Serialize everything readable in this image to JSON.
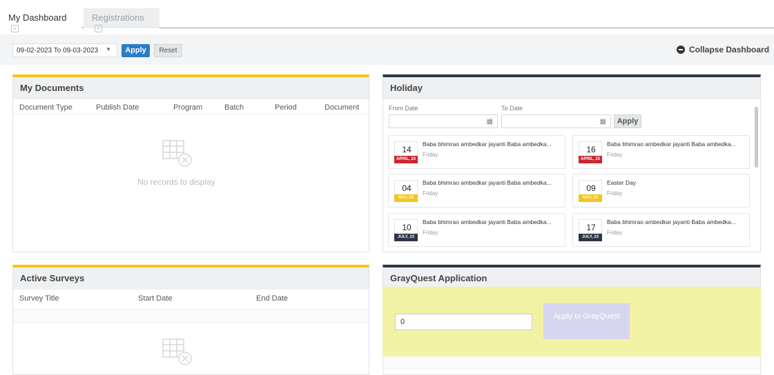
{
  "tabs": [
    {
      "label": "My Dashboard"
    },
    {
      "label": "Registrations"
    }
  ],
  "filters": {
    "date_range": "09-02-2023 To 09-03-2023",
    "apply_label": "Apply",
    "reset_label": "Reset",
    "collapse_label": "Collapse Dashboard"
  },
  "documents": {
    "title": "My Documents",
    "columns": [
      "Document Type",
      "Publish Date",
      "Program",
      "Batch",
      "Period",
      "Document"
    ],
    "empty_text": "No records to display"
  },
  "holiday": {
    "title": "Holiday",
    "from_label": "From Date",
    "to_label": "To Date",
    "apply_label": "Apply",
    "items": [
      {
        "day": "14",
        "month": "APRIL, 23",
        "title": "Baba bhimrao ambedkar jayanti Baba ambedka...",
        "weekday": "Friday",
        "color": "#c8282f"
      },
      {
        "day": "16",
        "month": "APRIL, 23",
        "title": "Baba bhimrao ambedkar jayanti Baba ambedka...",
        "weekday": "Friday",
        "color": "#c8282f"
      },
      {
        "day": "04",
        "month": "MAY, 23",
        "title": "Baba bhimrao ambedkar jayanti Baba ambedka...",
        "weekday": "Friday",
        "color": "#f5c518"
      },
      {
        "day": "09",
        "month": "MAY, 23",
        "title": "Easter Day",
        "weekday": "Friday",
        "color": "#f5c518"
      },
      {
        "day": "10",
        "month": "JULY, 23",
        "title": "Baba bhimrao ambedkar jayanti Baba ambedka...",
        "weekday": "Friday",
        "color": "#2d3446"
      },
      {
        "day": "17",
        "month": "JULY, 23",
        "title": "Baba bhimrao ambedkar jayanti Baba ambedka...",
        "weekday": "Friday",
        "color": "#2d3446"
      }
    ]
  },
  "surveys": {
    "title": "Active Surveys",
    "columns": [
      "Survey Title",
      "Start Date",
      "End Date"
    ]
  },
  "grayquest": {
    "title": "GrayQuest Application",
    "amount_value": "0",
    "apply_label": "Apply to GrayQuest"
  },
  "colors": {
    "accent_blue": "#2a7cc7",
    "panel_yellow": "#f5c518",
    "panel_navy": "#2d3446",
    "grayquest_band": "#f2f2a4"
  }
}
